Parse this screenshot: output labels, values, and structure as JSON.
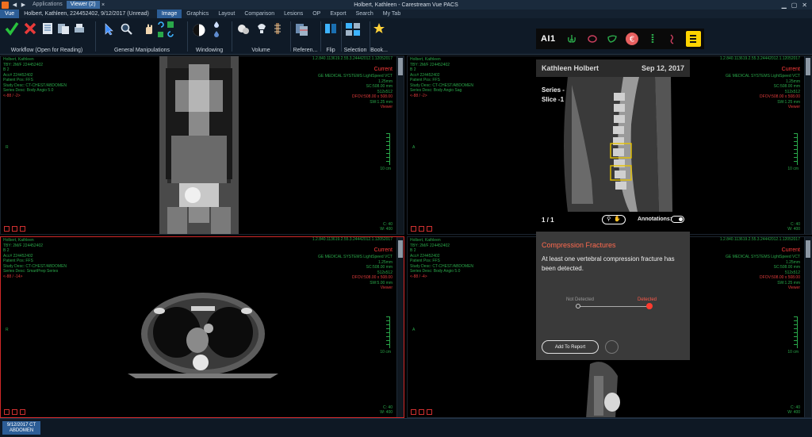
{
  "titlebar": {
    "tabs": [
      "Applications",
      "Viewer (2)"
    ],
    "title": "Holbert, Kathleen - Carestream Vue PACS",
    "close": "×"
  },
  "menubar": {
    "app": "Vue",
    "patient": "Holbert, Kathleen, 224452402, 9/12/2017 (Unread)",
    "items": [
      "Image",
      "Graphics",
      "Layout",
      "Comparison",
      "Lesions",
      "OP",
      "Export",
      "Search",
      "My Tab"
    ],
    "active": "Image"
  },
  "toolbar": {
    "groups": [
      "Workflow (Open for Reading)",
      "General Manipulations",
      "Windowing",
      "Volume",
      "Referen...",
      "Flip",
      "Selection",
      "Book..."
    ]
  },
  "ai": {
    "logo": "AI1",
    "colors": {
      "accent": "#ffd400",
      "alert": "#ff3b2f"
    }
  },
  "viewports": [
    {
      "left": [
        "Holbert, Kathleen",
        "TBY: 2M/F 224452402",
        "B 2",
        "Acc# 224452402",
        "Patient Pos: FFS",
        "Study Desc: CT-CHEST/ABDOMEN",
        "Series Desc: Body Angio 5.0"
      ],
      "left_red": "<-88 / -2>",
      "right": [
        "GE MEDICAL SYSTEMS LightSpeed VCT",
        "1.25mm",
        "SC:508.00 mm",
        "512x512",
        "DFOV:508.00 x 508.00",
        "SW:1.25 mm",
        "Viewer"
      ],
      "id": "1.2.840.113619.2.55.3.24442012.1.12052017",
      "current": "Current",
      "scale": "10 cm",
      "orient": "R",
      "cw": [
        "C: 40",
        "W: 400"
      ]
    },
    {
      "left": [
        "Holbert, Kathleen",
        "TBY: 2M/F 224452402",
        "B 2",
        "Acc# 224452402",
        "Patient Pos: FFS",
        "Study Desc: CT-CHEST/ABDOMEN",
        "Series Desc: Body Angio Sag"
      ],
      "left_red": "<-88 / -2>",
      "right": [
        "GE MEDICAL SYSTEMS LightSpeed VCT",
        "1.25mm",
        "SC:508.00 mm",
        "512x512",
        "DFOV:508.00 x 508.00",
        "SW:1.25 mm",
        "Viewer"
      ],
      "id": "1.2.840.113619.2.55.3.24442012.1.12052017",
      "current": "Current",
      "scale": "10 cm",
      "orient": "A",
      "cw": [
        "C: 40",
        "W: 400"
      ]
    },
    {
      "left": [
        "Holbert, Kathleen",
        "TBY: 2M/F 224452402",
        "B 2",
        "Acc# 224452402",
        "Patient Pos: FFS",
        "Study Desc: CT-CHEST/ABDOMEN",
        "Series Desc: SmartPrep Series"
      ],
      "left_red": "<-88 / -14>",
      "right": [
        "GE MEDICAL SYSTEMS LightSpeed VCT",
        "1.25mm",
        "SC:508.00 mm",
        "512x512",
        "DFOV:508.00 x 508.00",
        "SW:5.00 mm",
        "Viewer"
      ],
      "id": "1.2.840.113619.2.55.3.24442012.1.12052017",
      "current": "Current",
      "scale": "10 cm",
      "orient": "R",
      "cw": [
        "C: 40",
        "W: 400"
      ]
    },
    {
      "left": [
        "Holbert, Kathleen",
        "TBY: 2M/F 224452402",
        "B 2",
        "Acc# 224452402",
        "Patient Pos: FFS",
        "Study Desc: CT-CHEST/ABDOMEN",
        "Series Desc: Body Angio 5.0"
      ],
      "left_red": "<-88 / -4>",
      "right": [
        "GE MEDICAL SYSTEMS LightSpeed VCT",
        "1.25mm",
        "SC:508.00 mm",
        "512x512",
        "DFOV:508.00 x 508.00",
        "SW:1.25 mm",
        "Viewer"
      ],
      "id": "1.2.840.113619.2.55.3.24442012.1.12052017",
      "current": "Current",
      "scale": "10 cm",
      "orient": "A",
      "cw": [
        "C: 40",
        "W: 400"
      ]
    }
  ],
  "aipanel": {
    "patient": "Kathleen Holbert",
    "date": "Sep 12, 2017",
    "series_label": "Series -",
    "slice_label": "Slice -1",
    "count": "1 / 1",
    "annotations_label": "Annotations:",
    "finding_title": "Compression Fractures",
    "finding_desc": "At least one vertebral compression fracture has been detected.",
    "scale_left": "Not Detected",
    "scale_right": "Detected",
    "add_button": "Add To Report"
  },
  "statusbar": {
    "tab_line1": "9/12/2017 CT",
    "tab_line2": "ABDOMEN"
  }
}
